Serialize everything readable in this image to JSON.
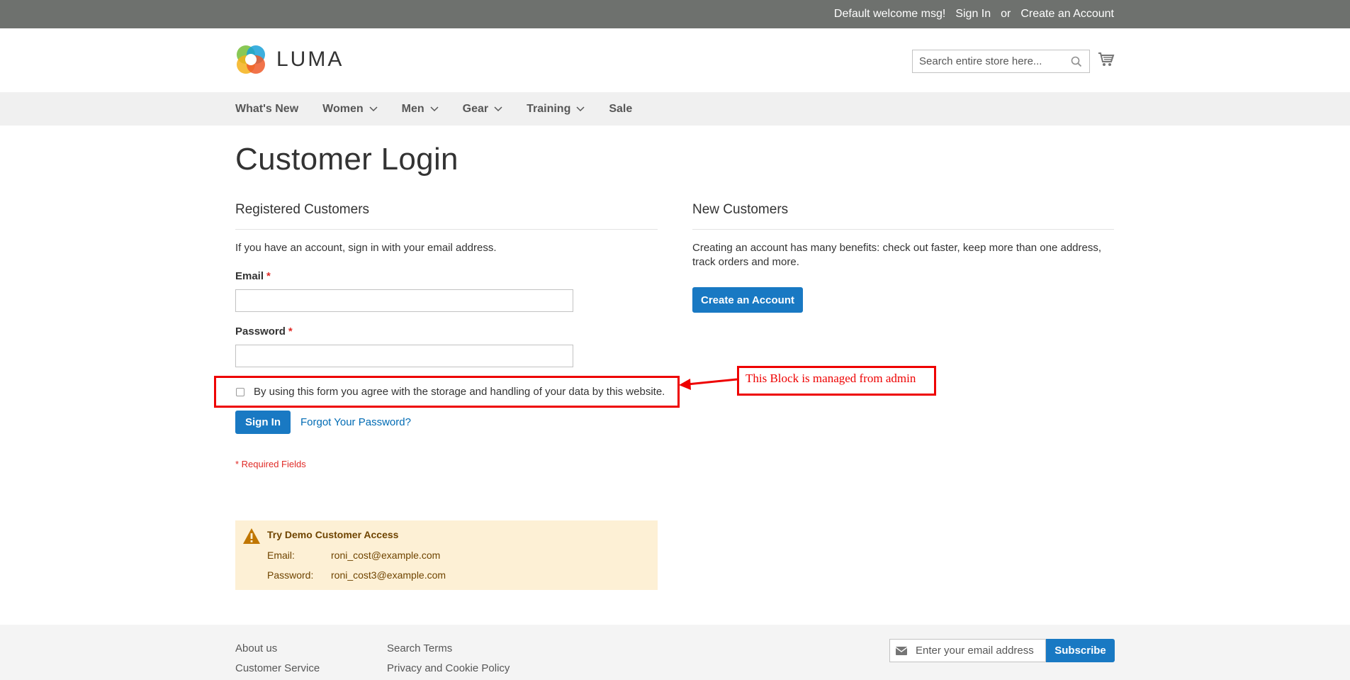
{
  "header": {
    "welcome": "Default welcome msg!",
    "sign_in": "Sign In",
    "or": "or",
    "create_account": "Create an Account",
    "logo_text": "LUMA",
    "search_placeholder": "Search entire store here..."
  },
  "nav": {
    "items": [
      {
        "label": "What's New"
      },
      {
        "label": "Women"
      },
      {
        "label": "Men"
      },
      {
        "label": "Gear"
      },
      {
        "label": "Training"
      },
      {
        "label": "Sale"
      }
    ]
  },
  "page": {
    "title": "Customer Login"
  },
  "registered": {
    "title": "Registered Customers",
    "intro": "If you have an account, sign in with your email address.",
    "email_label": "Email",
    "password_label": "Password",
    "required_mark": "*",
    "consent": "By using this form you agree with the storage and handling of your data by this website.",
    "sign_in_button": "Sign In",
    "forgot_link": "Forgot Your Password?",
    "required_note": "* Required Fields"
  },
  "annotation": {
    "text": "This Block is managed from admin"
  },
  "demo": {
    "title": "Try Demo Customer Access",
    "email_key": "Email:",
    "email_value": "roni_cost@example.com",
    "password_key": "Password:",
    "password_value": "roni_cost3@example.com"
  },
  "new_customers": {
    "title": "New Customers",
    "text": "Creating an account has many benefits: check out faster, keep more than one address, track orders and more.",
    "create_button": "Create an Account"
  },
  "footer": {
    "col1": [
      "About us",
      "Customer Service"
    ],
    "col2": [
      "Search Terms",
      "Privacy and Cookie Policy"
    ],
    "newsletter_placeholder": "Enter your email address",
    "subscribe": "Subscribe"
  },
  "colors": {
    "primary": "#1979c3",
    "header_bar": "#6e716e",
    "nav_bg": "#f0f0f0",
    "required": "#e02b27",
    "annotation": "#ee0000",
    "demo_bg": "#fdf0d5"
  }
}
